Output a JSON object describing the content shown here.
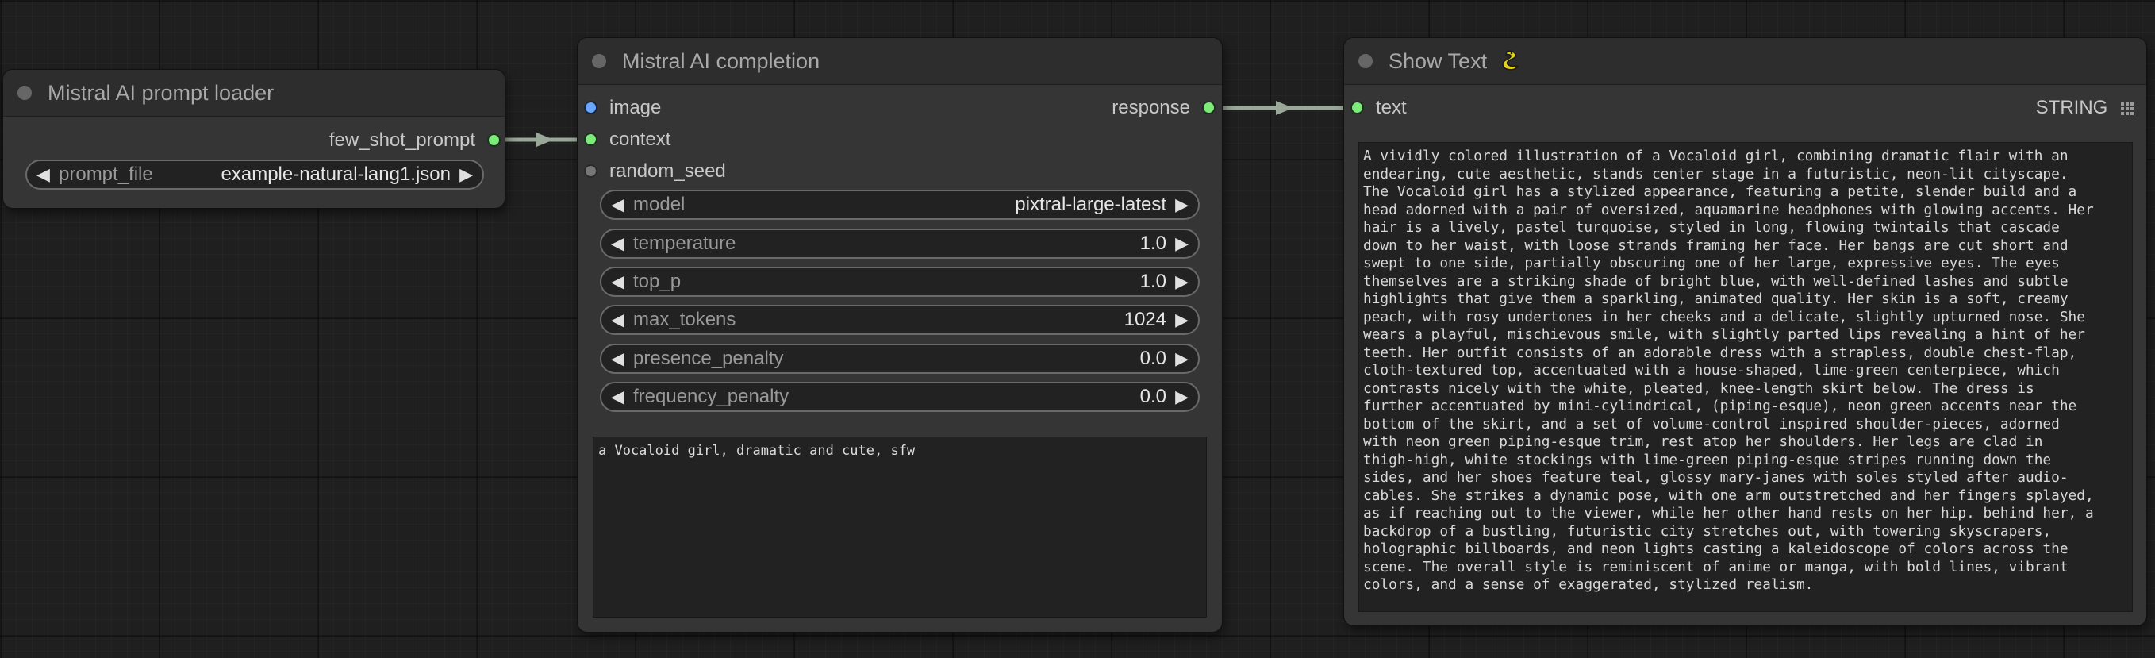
{
  "nodes": {
    "loader": {
      "title": "Mistral AI prompt loader",
      "output_label": "few_shot_prompt",
      "widget": {
        "label": "prompt_file",
        "value": "example-natural-lang1.json"
      }
    },
    "completion": {
      "title": "Mistral AI completion",
      "inputs": [
        "image",
        "context",
        "random_seed"
      ],
      "output_label": "response",
      "widgets": [
        {
          "label": "model",
          "value": "pixtral-large-latest"
        },
        {
          "label": "temperature",
          "value": "1.0"
        },
        {
          "label": "top_p",
          "value": "1.0"
        },
        {
          "label": "max_tokens",
          "value": "1024"
        },
        {
          "label": "presence_penalty",
          "value": "0.0"
        },
        {
          "label": "frequency_penalty",
          "value": "0.0"
        }
      ],
      "prompt_text": "a Vocaloid girl, dramatic and cute, sfw"
    },
    "show_text": {
      "title": "Show Text",
      "title_icon": "snake-icon",
      "input_label": "text",
      "type_label": "STRING",
      "output_text": "A vividly colored illustration of a Vocaloid girl, combining dramatic flair with an\nendearing, cute aesthetic, stands center stage in a futuristic, neon-lit cityscape.\nThe Vocaloid girl has a stylized appearance, featuring a petite, slender build and a\nhead adorned with a pair of oversized, aquamarine headphones with glowing accents. Her\nhair is a lively, pastel turquoise, styled in long, flowing twintails that cascade\ndown to her waist, with loose strands framing her face. Her bangs are cut short and\nswept to one side, partially obscuring one of her large, expressive eyes. The eyes\nthemselves are a striking shade of bright blue, with well-defined lashes and subtle\nhighlights that give them a sparkling, animated quality. Her skin is a soft, creamy\npeach, with rosy undertones in her cheeks and a delicate, slightly upturned nose. She\nwears a playful, mischievous smile, with slightly parted lips revealing a hint of her\nteeth. Her outfit consists of an adorable dress with a strapless, double chest-flap,\ncloth-textured top, accentuated with a house-shaped, lime-green centerpiece, which\ncontrasts nicely with the white, pleated, knee-length skirt below. The dress is\nfurther accentuated by mini-cylindrical, (piping-esque), neon green accents near the\nbottom of the skirt, and a set of volume-control inspired shoulder-pieces, adorned\nwith neon green piping-esque trim, rest atop her shoulders. Her legs are clad in\nthigh-high, white stockings with lime-green piping-esque stripes running down the\nsides, and her shoes feature teal, glossy mary-janes with soles styled after audio-\ncables. She strikes a dynamic pose, with one arm outstretched and her fingers splayed,\nas if reaching out to the viewer, while her other hand rests on her hip. behind her, a\nbackdrop of a bustling, futuristic city stretches out, with towering skyscrapers,\nholographic billboards, and neon lights casting a kaleidoscope of colors across the\nscene. The overall style is reminiscent of anime or manga, with bold lines, vibrant\ncolors, and a sense of exaggerated, stylized realism."
    }
  },
  "colors": {
    "link": "#9aa89a",
    "slot_connected": "#7CEB7A",
    "slot_image": "#6aa8ff",
    "slot_unconnected": "#777777"
  }
}
